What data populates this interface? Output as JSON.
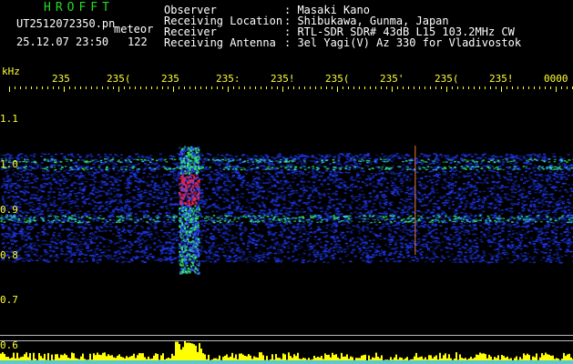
{
  "header": {
    "brand": "HROFFT",
    "filename": "UT2512072350.pn",
    "meteor_label": "meteor",
    "datetime": "25.12.07 23:50",
    "count": "122"
  },
  "station": {
    "labels": [
      "Observer",
      "Receiving Location",
      "Receiver",
      "Receiving Antenna"
    ],
    "values": [
      ": Masaki Kano",
      ": Shibukawa, Gunma, Japan",
      ": RTL-SDR SDR# 43dB L15 103.2MHz CW",
      ": 3el Yagi(V) Az 330 for Vladivostok"
    ]
  },
  "axis": {
    "unit": "kHz",
    "y_ticks": [
      "1.1",
      "1.0",
      "0.9",
      "0.8",
      "0.7",
      "0.6"
    ],
    "x_ticks": [
      "235",
      "235(",
      "235",
      "235:",
      "235!",
      "235(",
      "235'",
      "235(",
      "235!",
      "0000"
    ]
  },
  "colors": {
    "noise_blue": "#1f3cff",
    "signal_green": "#33ff66",
    "signal_red": "#ff2244",
    "bar_yellow": "#ffff00",
    "axis_yellow": "#ffff33"
  }
}
